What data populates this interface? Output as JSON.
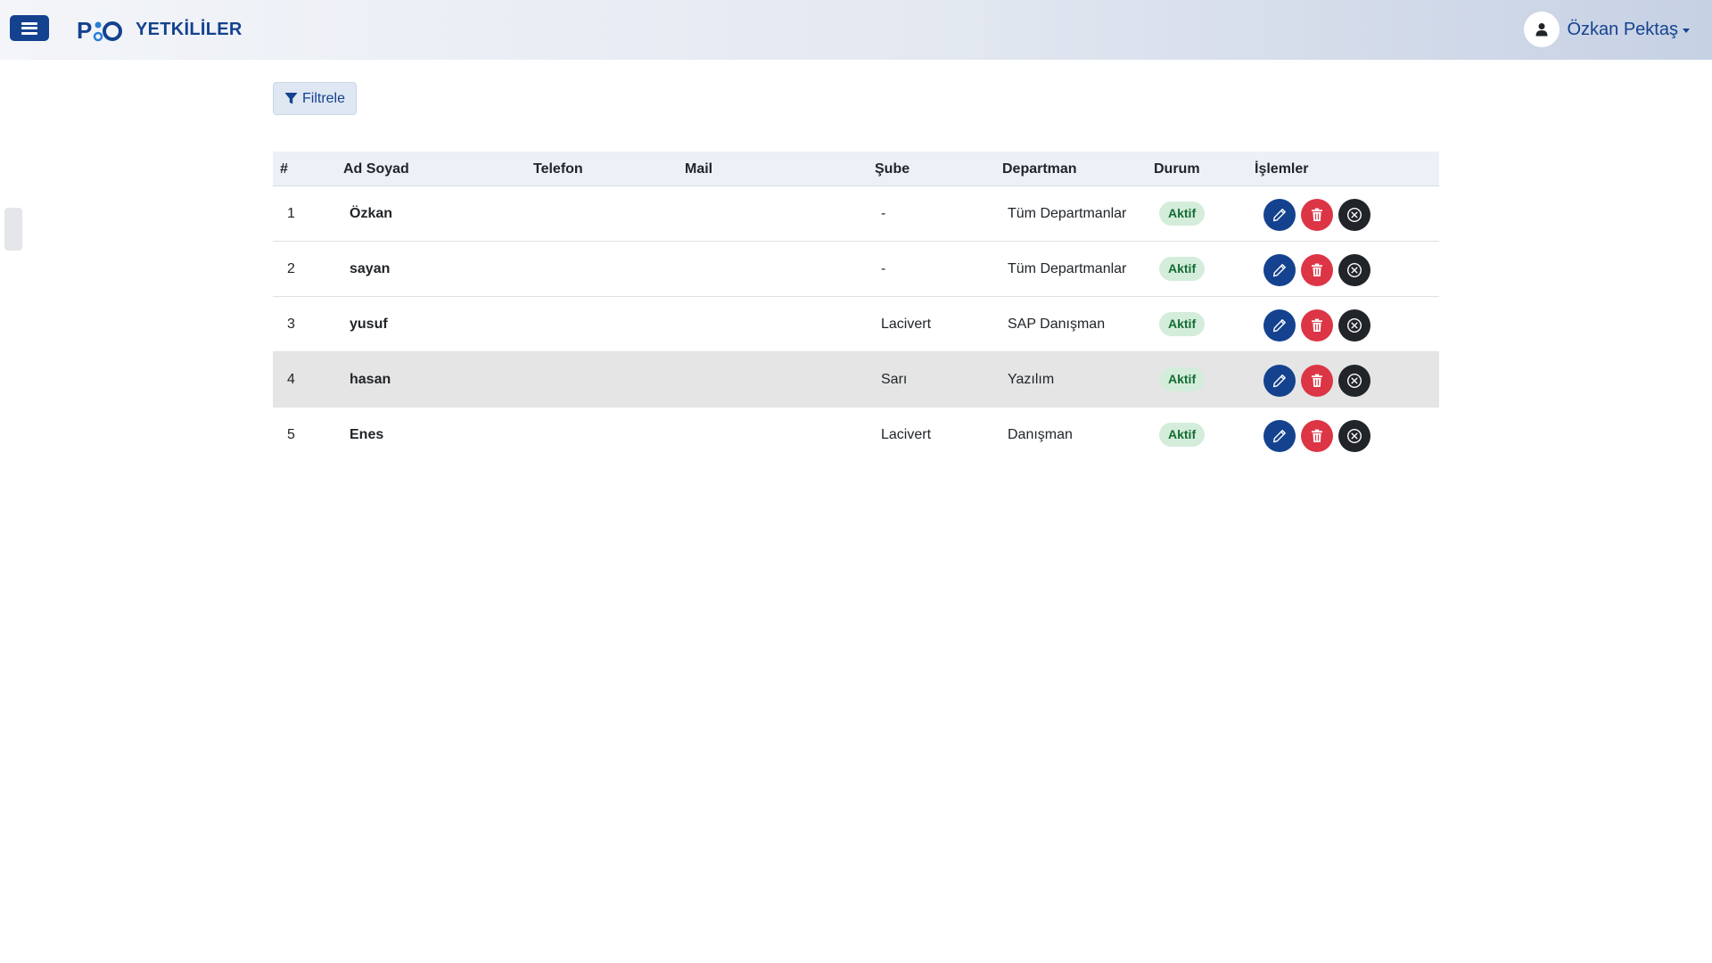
{
  "header": {
    "logo_text": "PiO",
    "page_title": "YETKİLİLER",
    "user_name": "Özkan Pektaş"
  },
  "toolbar": {
    "filter_label": "Filtrele"
  },
  "table": {
    "columns": [
      "#",
      "Ad Soyad",
      "Telefon",
      "Mail",
      "Şube",
      "Departman",
      "Durum",
      "İşlemler"
    ],
    "rows": [
      {
        "no": "1",
        "name": "Özkan",
        "phone": "",
        "mail": "",
        "branch": "-",
        "department": "Tüm Departmanlar",
        "status": "Aktif"
      },
      {
        "no": "2",
        "name": "sayan",
        "phone": "",
        "mail": "",
        "branch": "-",
        "department": "Tüm Departmanlar",
        "status": "Aktif"
      },
      {
        "no": "3",
        "name": "yusuf",
        "phone": "",
        "mail": "",
        "branch": "Lacivert",
        "department": "SAP Danışman",
        "status": "Aktif"
      },
      {
        "no": "4",
        "name": "hasan",
        "phone": "",
        "mail": "",
        "branch": "Sarı",
        "department": "Yazılım",
        "status": "Aktif"
      },
      {
        "no": "5",
        "name": "Enes",
        "phone": "",
        "mail": "",
        "branch": "Lacivert",
        "department": "Danışman",
        "status": "Aktif"
      }
    ],
    "highlighted_row": 4
  },
  "icons": {
    "menu": "hamburger-menu-icon",
    "user": "user-icon",
    "filter": "filter-funnel-icon",
    "edit": "pencil-icon",
    "delete": "trash-icon",
    "cancel": "circle-x-icon"
  },
  "colors": {
    "brand": "#14428f",
    "danger": "#dc3545",
    "dark": "#212529",
    "status_bg": "#d4eddb",
    "status_text": "#146c33"
  }
}
